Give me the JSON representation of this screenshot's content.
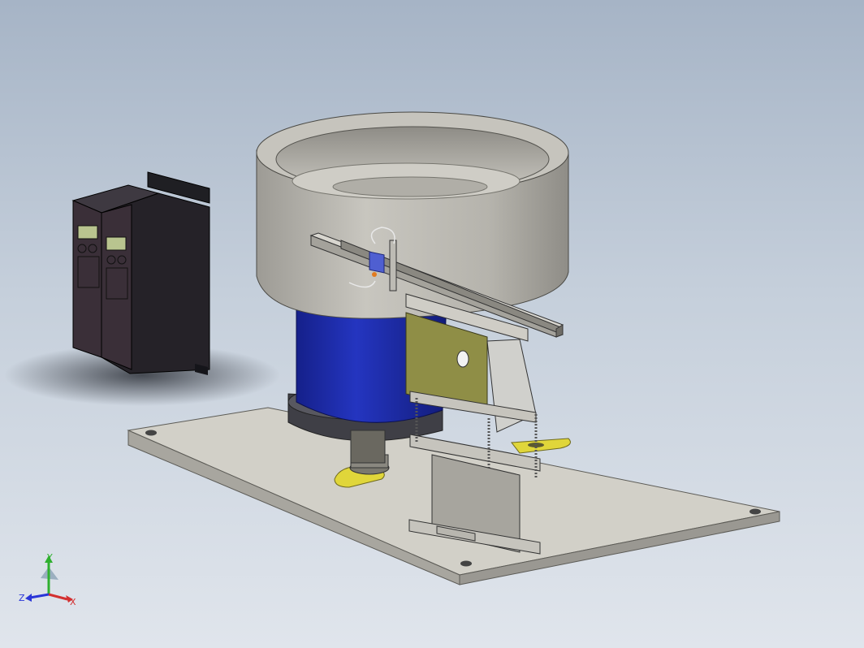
{
  "viewport": {
    "background_top": "#a6b4c6",
    "background_bottom": "#e0e5ec"
  },
  "model_colors": {
    "bowl": "#b9b7b0",
    "base_plate": "#d2d0c8",
    "motor_housing": "#1e2fa6",
    "feet": "#e0d63a",
    "controller": "#3a2f38",
    "sensor": "#4f5fd1",
    "bracket_panel": "#8f8e46"
  },
  "triad": {
    "icon": "coordinate-triad-icon",
    "x_label": "X",
    "y_label": "Y",
    "z_label": "Z",
    "x_color": "#d33030",
    "y_color": "#2fb02f",
    "z_color": "#2a36d8"
  }
}
